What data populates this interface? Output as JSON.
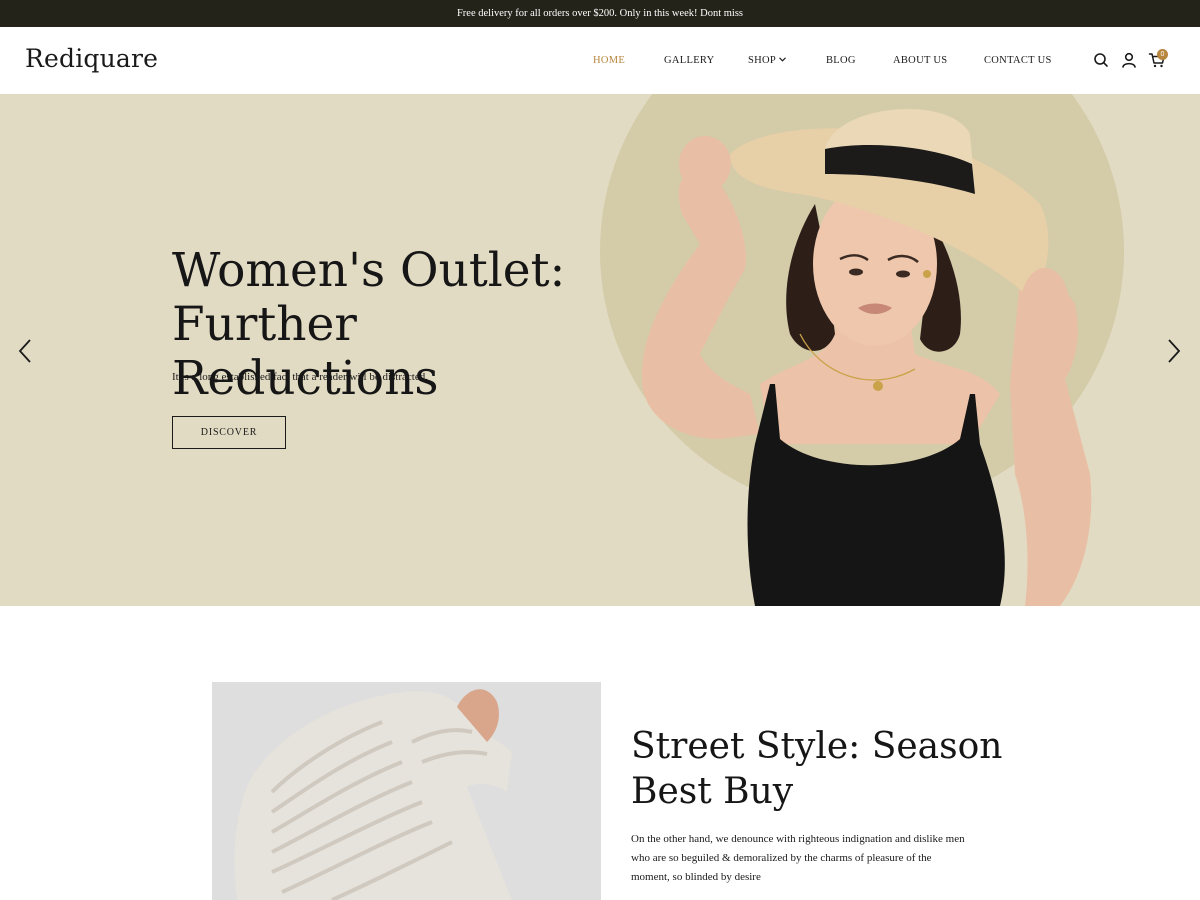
{
  "announcement": "Free delivery for all orders over $200. Only in this week! Dont miss",
  "brand": "Rediquare",
  "nav": {
    "home": "HOME",
    "gallery": "GALLERY",
    "shop": "SHOP",
    "blog": "BLOG",
    "about": "ABOUT US",
    "contact": "CONTACT US"
  },
  "header_icons": [
    "search-icon",
    "user-icon",
    "cart-icon"
  ],
  "cart_count": "0",
  "colors": {
    "topbar": "#24231a",
    "accent": "#b8863e",
    "hero_bg": "#e2dbc3",
    "hero_circle": "#d4cba8"
  },
  "hero": {
    "title_line1": "Women's Outlet:",
    "title_line2": "Further Reductions",
    "subtitle": "It is a long established fact that a reader will be distracted.",
    "cta": "DISCOVER"
  },
  "feature": {
    "title_line1": "Street Style: Season",
    "title_line2": "Best Buy",
    "text_line1": "On the other hand, we denounce with righteous indignation and dislike men",
    "text_line2": "who are so beguiled & demoralized by the charms of pleasure of the",
    "text_line3": "moment, so blinded by desire"
  }
}
